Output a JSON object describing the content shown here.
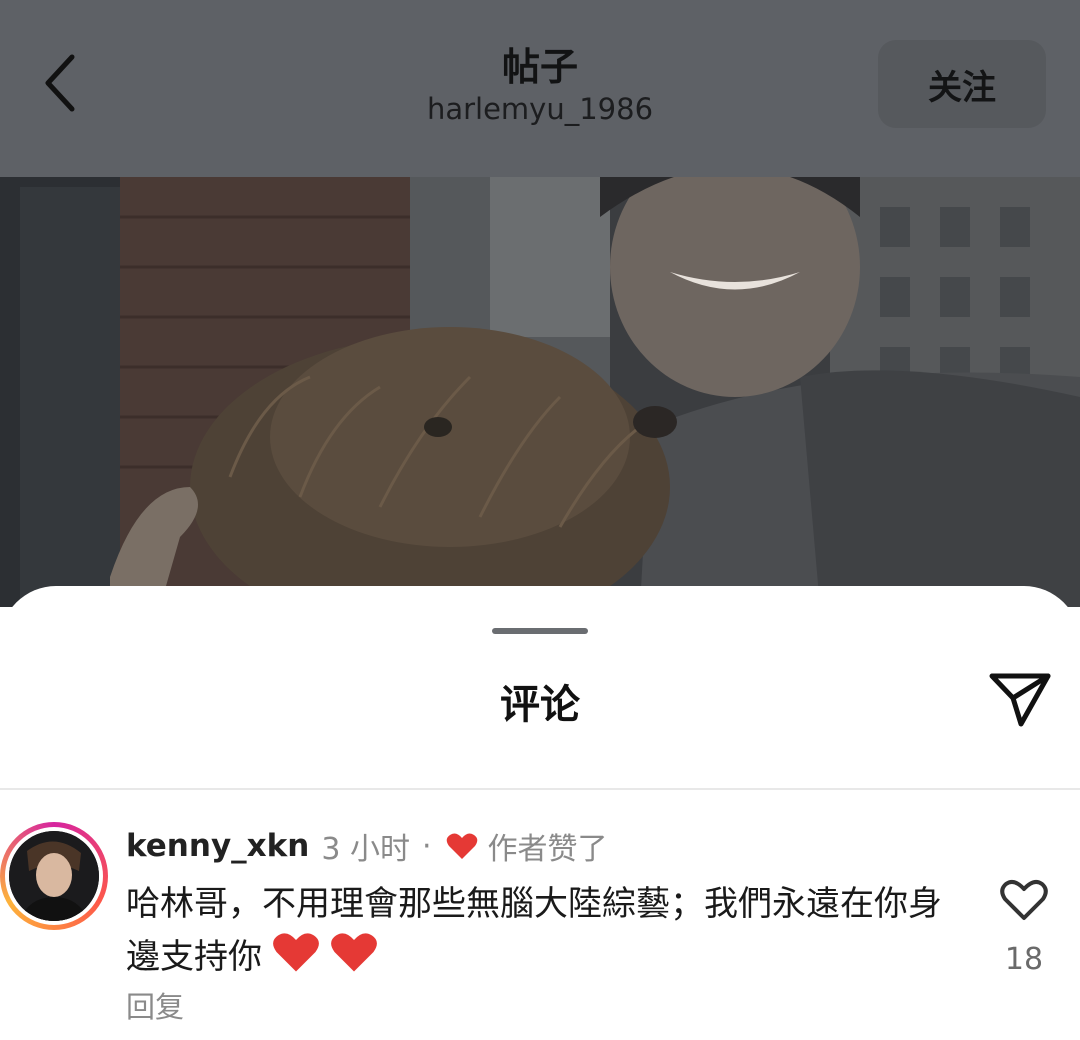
{
  "header": {
    "title": "帖子",
    "username": "harlemyu_1986",
    "follow_label": "关注"
  },
  "sheet": {
    "title": "评论"
  },
  "comment": {
    "username": "kenny_xkn",
    "time": "3 小时",
    "separator": "·",
    "liked_by_author": "作者赞了",
    "text": "哈林哥，不用理會那些無腦大陸綜藝；我們永遠在你身邊支持你",
    "emojis": [
      "❤️",
      "❤️"
    ],
    "reply_label": "回复",
    "like_count": "18"
  },
  "icons": {
    "back": "chevron-left-icon",
    "share": "paper-plane-icon",
    "liked": "heart-filled-icon",
    "like": "heart-outline-icon"
  },
  "colors": {
    "header_dim": "#5e6166",
    "heart_red": "#e53935",
    "muted_text": "#8a8a8a"
  }
}
